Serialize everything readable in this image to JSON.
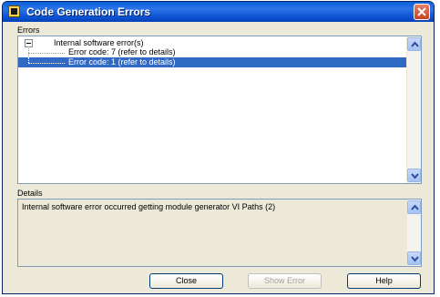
{
  "window": {
    "title": "Code Generation Errors"
  },
  "errors": {
    "label": "Errors",
    "root": "Internal software error(s)",
    "items": [
      {
        "label": "Error code: 7 (refer to details)",
        "selected": false
      },
      {
        "label": "Error code: 1 (refer to details)",
        "selected": true
      }
    ]
  },
  "details": {
    "label": "Details",
    "text": "Internal software error occurred getting module generator VI Paths (2)"
  },
  "buttons": {
    "close": "Close",
    "show_error": "Show Error",
    "help": "Help"
  },
  "colors": {
    "title_bar": "#0a5fd8",
    "selection": "#316ac5",
    "dialog_bg": "#ece9d8"
  },
  "icons": {
    "title": "labview-app-icon",
    "close": "close-x-icon",
    "scroll_up": "chevron-up-icon",
    "scroll_down": "chevron-down-icon",
    "tree": "tree-collapse-icon"
  }
}
